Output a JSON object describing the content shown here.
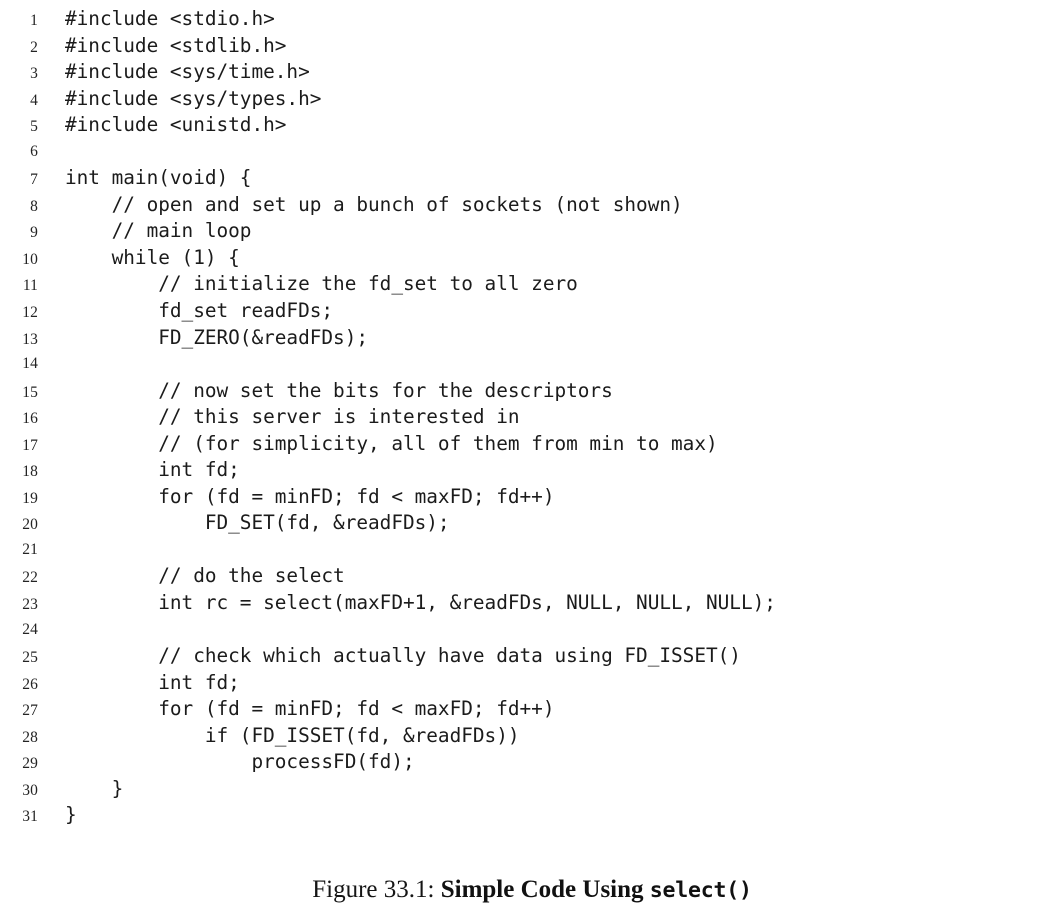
{
  "page": {
    "background_color": "#ffffff",
    "text_color": "#1a1a1a"
  },
  "code_listing": {
    "language": "c",
    "line_number_color": "#232323",
    "code_color": "#1b1b1b",
    "lines": [
      {
        "number": "1",
        "code": "#include <stdio.h>"
      },
      {
        "number": "2",
        "code": "#include <stdlib.h>"
      },
      {
        "number": "3",
        "code": "#include <sys/time.h>"
      },
      {
        "number": "4",
        "code": "#include <sys/types.h>"
      },
      {
        "number": "5",
        "code": "#include <unistd.h>"
      },
      {
        "number": "6",
        "code": ""
      },
      {
        "number": "7",
        "code": "int main(void) {"
      },
      {
        "number": "8",
        "code": "    // open and set up a bunch of sockets (not shown)"
      },
      {
        "number": "9",
        "code": "    // main loop"
      },
      {
        "number": "10",
        "code": "    while (1) {"
      },
      {
        "number": "11",
        "code": "        // initialize the fd_set to all zero"
      },
      {
        "number": "12",
        "code": "        fd_set readFDs;"
      },
      {
        "number": "13",
        "code": "        FD_ZERO(&readFDs);"
      },
      {
        "number": "14",
        "code": ""
      },
      {
        "number": "15",
        "code": "        // now set the bits for the descriptors"
      },
      {
        "number": "16",
        "code": "        // this server is interested in"
      },
      {
        "number": "17",
        "code": "        // (for simplicity, all of them from min to max)"
      },
      {
        "number": "18",
        "code": "        int fd;"
      },
      {
        "number": "19",
        "code": "        for (fd = minFD; fd < maxFD; fd++)"
      },
      {
        "number": "20",
        "code": "            FD_SET(fd, &readFDs);"
      },
      {
        "number": "21",
        "code": ""
      },
      {
        "number": "22",
        "code": "        // do the select"
      },
      {
        "number": "23",
        "code": "        int rc = select(maxFD+1, &readFDs, NULL, NULL, NULL);"
      },
      {
        "number": "24",
        "code": ""
      },
      {
        "number": "25",
        "code": "        // check which actually have data using FD_ISSET()"
      },
      {
        "number": "26",
        "code": "        int fd;"
      },
      {
        "number": "27",
        "code": "        for (fd = minFD; fd < maxFD; fd++)"
      },
      {
        "number": "28",
        "code": "            if (FD_ISSET(fd, &readFDs))"
      },
      {
        "number": "29",
        "code": "                processFD(fd);"
      },
      {
        "number": "30",
        "code": "    }"
      },
      {
        "number": "31",
        "code": "}"
      }
    ]
  },
  "caption": {
    "prefix": "Figure 33.1:",
    "title": "Simple Code Using",
    "mono": "select()",
    "full_text": "Figure 33.1: Simple Code Using select()"
  }
}
